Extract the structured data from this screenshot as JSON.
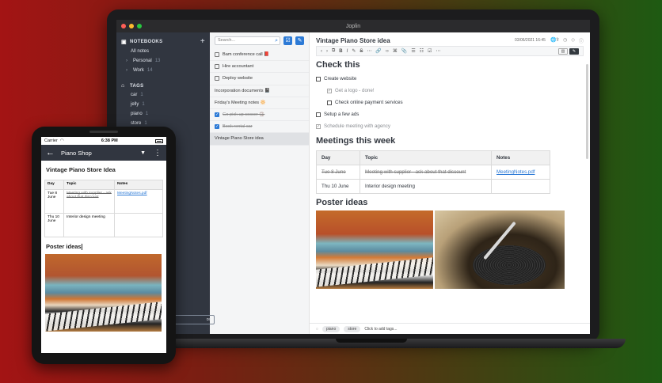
{
  "window": {
    "title": "Joplin"
  },
  "sidebar": {
    "notebooks_heading": "NOTEBOOKS",
    "add_label": "+",
    "all_notes": "All notes",
    "notebooks": [
      {
        "name": "Personal",
        "count": "13"
      },
      {
        "name": "Work",
        "count": "14"
      }
    ],
    "tags_heading": "TAGS",
    "tags": [
      {
        "name": "car",
        "count": "1"
      },
      {
        "name": "jelly",
        "count": "1"
      },
      {
        "name": "piano",
        "count": "1"
      },
      {
        "name": "store",
        "count": "1"
      }
    ],
    "sync_label": "ce"
  },
  "notelist": {
    "search_placeholder": "Search...",
    "notes": [
      {
        "title": "Bam conference call 📕",
        "todo": true,
        "done": false
      },
      {
        "title": "Hire accountant",
        "todo": true,
        "done": false
      },
      {
        "title": "Deploy website",
        "todo": true,
        "done": false
      },
      {
        "title": "Incorporation documents 📓",
        "todo": false,
        "done": false
      },
      {
        "title": "Friday's Meeting notes 🔆",
        "todo": false,
        "done": false
      },
      {
        "title": "Go pick up soccer 🏐",
        "todo": true,
        "done": true
      },
      {
        "title": "Book rental car",
        "todo": true,
        "done": true
      },
      {
        "title": "Vintage Piano Store idea",
        "todo": false,
        "done": false,
        "selected": true
      }
    ]
  },
  "editor": {
    "title": "Vintage Piano Store idea",
    "date": "03/06/2021 16:45",
    "lang": "fr",
    "toolbar": [
      "‹",
      "›",
      "⧉",
      "B",
      "I",
      "✎",
      "S",
      "⋯",
      "🔗",
      "‹›",
      "⌘",
      "📎",
      "☰",
      "☷",
      "☑",
      "⋯"
    ],
    "check_heading": "Check this",
    "todos": [
      {
        "text": "Create website",
        "level": 0,
        "done": false,
        "faded": false
      },
      {
        "text": "Get a logo - done!",
        "level": 1,
        "done": false,
        "faded": true,
        "checked": true
      },
      {
        "text": "Check online payment services",
        "level": 1,
        "done": false,
        "faded": false
      },
      {
        "text": "Setup a few ads",
        "level": 0,
        "done": false,
        "faded": false
      },
      {
        "text": "Schedule meeting with agency",
        "level": 0,
        "done": false,
        "faded": true,
        "checked": true
      }
    ],
    "meetings_heading": "Meetings this week",
    "table": {
      "headers": [
        "Day",
        "Topic",
        "Notes"
      ],
      "rows": [
        {
          "day": "Tue 8 June",
          "topic": "Meeting with supplier - ask about that discount",
          "notes": "MeetingNotes.pdf",
          "strike": true
        },
        {
          "day": "Thu 10 June",
          "topic": "Interior design meeting",
          "notes": "",
          "strike": false
        }
      ]
    },
    "poster_heading": "Poster ideas",
    "tags": [
      "piano",
      "store"
    ],
    "add_tags": "Click to add tags..."
  },
  "phone": {
    "carrier": "Carrier",
    "time": "6:38 PM",
    "notebook": "Piano Shop",
    "note_title": "Vintage Piano Store Idea",
    "table": {
      "headers": [
        "Day",
        "Topic",
        "Notes"
      ],
      "rows": [
        {
          "day": "Tue 8 June",
          "topic": "Meeting with supplier - ask about that discount",
          "notes": "MeetingNotes.pdf",
          "strike": true
        },
        {
          "day": "Thu 10 June",
          "topic": "Interior design meeting",
          "notes": "",
          "strike": false
        }
      ]
    },
    "poster_heading": "Poster ideas"
  },
  "colors": {
    "sidebar_bg": "#313640",
    "accent": "#2c7ad6",
    "traffic_red": "#ff5f57",
    "traffic_yellow": "#febc2e",
    "traffic_green": "#28c840"
  }
}
